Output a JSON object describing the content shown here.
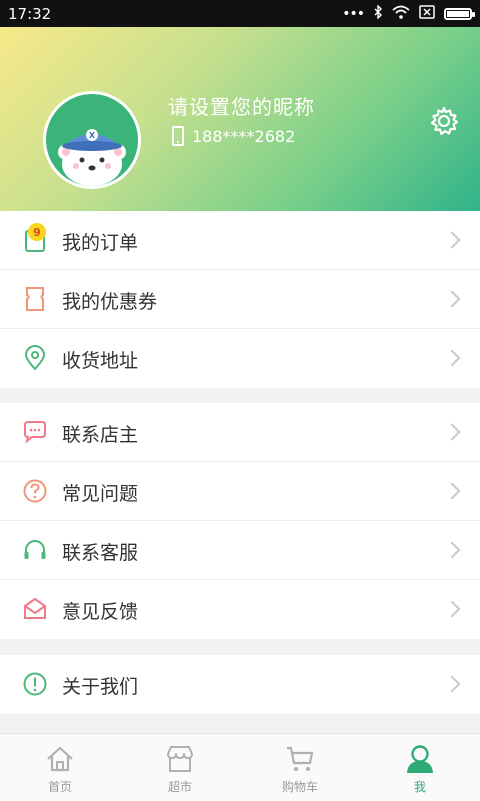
{
  "status_bar": {
    "time": "17:32",
    "icons": [
      "more-dots-icon",
      "bluetooth-icon",
      "wifi-icon",
      "sim-off-icon",
      "battery-icon"
    ]
  },
  "profile": {
    "nickname": "请设置您的昵称",
    "phone": "188****2682",
    "avatar": "avatar-icon",
    "settings_icon": "gear-icon"
  },
  "menu": {
    "group1": [
      {
        "label": "我的订单",
        "icon": "order-icon",
        "badge": "9"
      },
      {
        "label": "我的优惠券",
        "icon": "coupon-icon"
      },
      {
        "label": "收货地址",
        "icon": "location-pin-icon"
      }
    ],
    "group2": [
      {
        "label": "联系店主",
        "icon": "chat-bubble-icon"
      },
      {
        "label": "常见问题",
        "icon": "question-icon"
      },
      {
        "label": "联系客服",
        "icon": "headset-icon"
      },
      {
        "label": "意见反馈",
        "icon": "envelope-icon"
      }
    ],
    "group3": [
      {
        "label": "关于我们",
        "icon": "info-icon"
      }
    ]
  },
  "tabbar": {
    "tabs": [
      {
        "label": "首页",
        "icon": "home-icon",
        "active": false
      },
      {
        "label": "超市",
        "icon": "store-icon",
        "active": false
      },
      {
        "label": "购物车",
        "icon": "cart-icon",
        "active": false
      },
      {
        "label": "我",
        "icon": "user-icon",
        "active": true
      }
    ]
  },
  "colors": {
    "accent": "#2eaa76",
    "badge": "#f9d51c",
    "coupon": "#f1967a",
    "pink": "#f07a8a"
  }
}
